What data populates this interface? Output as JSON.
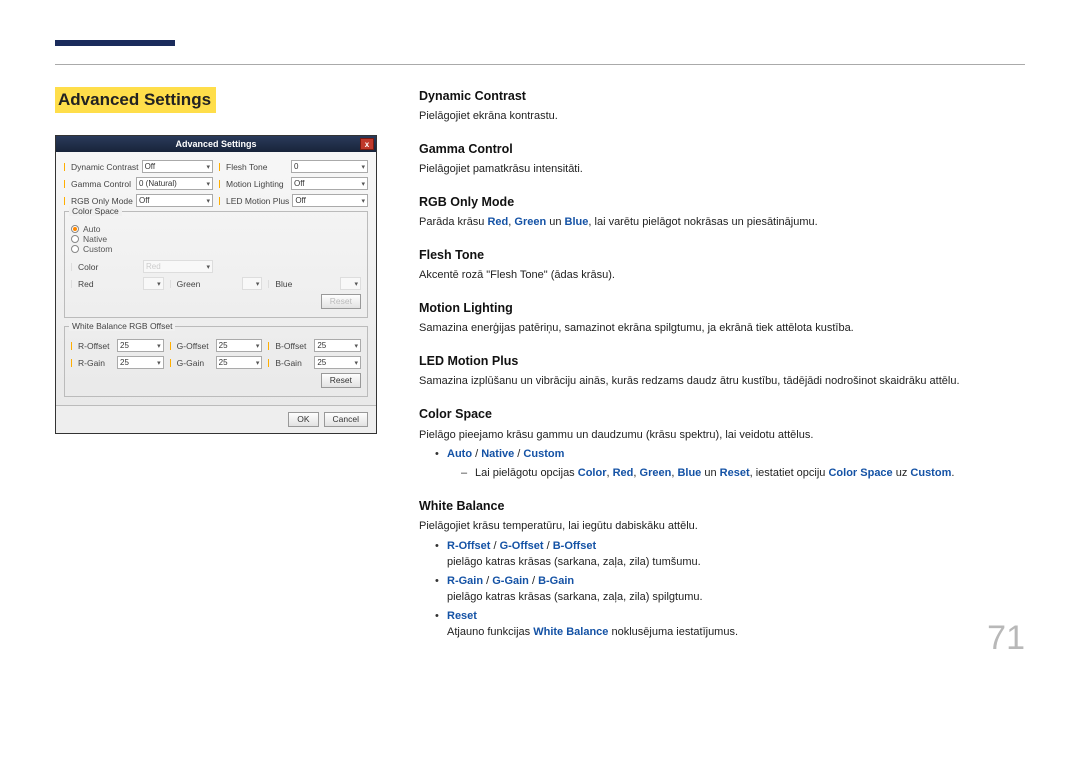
{
  "page_number": "71",
  "left": {
    "title": "Advanced Settings",
    "osd": {
      "title": "Advanced Settings",
      "close": "x",
      "rows": [
        {
          "l": "Dynamic Contrast",
          "lv": "Off",
          "r": "Flesh Tone",
          "rv": "0"
        },
        {
          "l": "Gamma Control",
          "lv": "0 (Natural)",
          "r": "Motion Lighting",
          "rv": "Off"
        },
        {
          "l": "RGB Only Mode",
          "lv": "Off",
          "r": "LED Motion Plus",
          "rv": "Off"
        }
      ],
      "colorspace": {
        "legend": "Color Space",
        "auto": "Auto",
        "native": "Native",
        "custom": "Custom",
        "color": "Color",
        "red": "Red",
        "green": "Green",
        "blue": "Blue",
        "reset": "Reset"
      },
      "wb": {
        "legend": "White Balance RGB Offset",
        "r1": [
          {
            "n": "R-Offset",
            "v": "25"
          },
          {
            "n": "G-Offset",
            "v": "25"
          },
          {
            "n": "B-Offset",
            "v": "25"
          }
        ],
        "r2": [
          {
            "n": "R-Gain",
            "v": "25"
          },
          {
            "n": "G-Gain",
            "v": "25"
          },
          {
            "n": "B-Gain",
            "v": "25"
          }
        ],
        "reset": "Reset"
      },
      "ok": "OK",
      "cancel": "Cancel"
    }
  },
  "right": {
    "dynamic_contrast": {
      "title": "Dynamic Contrast",
      "body": "Pielāgojiet ekrāna kontrastu."
    },
    "gamma_control": {
      "title": "Gamma Control",
      "body": "Pielāgojiet pamatkrāsu intensitāti."
    },
    "rgb_only": {
      "title": "RGB Only Mode",
      "pre": "Parāda krāsu ",
      "red": "Red",
      "sep1": ", ",
      "green": "Green",
      "sep2": " un ",
      "blue": "Blue",
      "post": ", lai varētu pielāgot nokrāsas un piesātinājumu."
    },
    "flesh_tone": {
      "title": "Flesh Tone",
      "body": "Akcentē rozā \"Flesh Tone\" (ādas krāsu)."
    },
    "motion_lighting": {
      "title": "Motion Lighting",
      "body": "Samazina enerģijas patēriņu, samazinot ekrāna spilgtumu, ja ekrānā tiek attēlota kustība."
    },
    "led_motion_plus": {
      "title": "LED Motion Plus",
      "body": "Samazina izplūšanu un vibrāciju ainās, kurās redzams daudz ātru kustību, tādējādi nodrošinot skaidrāku attēlu."
    },
    "color_space": {
      "title": "Color Space",
      "body": "Pielāgo pieejamo krāsu gammu un daudzumu (krāsu spektru), lai veidotu attēlus.",
      "li1": {
        "auto": "Auto",
        "s1": " / ",
        "native": "Native",
        "s2": " / ",
        "custom": "Custom"
      },
      "li2": {
        "pre": "Lai pielāgotu opcijas ",
        "color": "Color",
        "s1": ", ",
        "red": "Red",
        "s2": ", ",
        "green": "Green",
        "s3": ", ",
        "blue": "Blue",
        "s4": " un ",
        "reset": "Reset",
        "mid": ", iestatiet opciju ",
        "cs": "Color Space",
        "s5": " uz ",
        "custom": "Custom",
        "post": "."
      }
    },
    "white_balance": {
      "title": "White Balance",
      "body": "Pielāgojiet krāsu temperatūru, lai iegūtu dabiskāku attēlu.",
      "li1": {
        "roff": "R-Offset",
        "s1": " / ",
        "goff": "G-Offset",
        "s2": " / ",
        "boff": "B-Offset",
        "desc": "pielāgo katras krāsas (sarkana, zaļa, zila) tumšumu."
      },
      "li2": {
        "rgain": "R-Gain",
        "s1": " / ",
        "ggain": "G-Gain",
        "s2": " / ",
        "bgain": "B-Gain",
        "desc": "pielāgo katras krāsas (sarkana, zaļa, zila) spilgtumu."
      },
      "li3": {
        "reset": "Reset",
        "pre": "Atjauno funkcijas ",
        "wb": "White Balance",
        "post": " noklusējuma iestatījumus."
      }
    }
  }
}
